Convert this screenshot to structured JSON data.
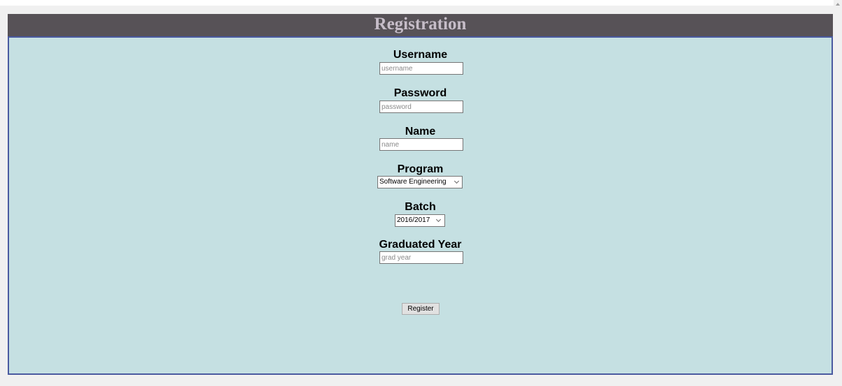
{
  "header": {
    "title": "Registration"
  },
  "form": {
    "username": {
      "label": "Username",
      "placeholder": "username",
      "value": ""
    },
    "password": {
      "label": "Password",
      "placeholder": "password",
      "value": ""
    },
    "name": {
      "label": "Name",
      "placeholder": "name",
      "value": ""
    },
    "program": {
      "label": "Program",
      "selected": "Software Engineering"
    },
    "batch": {
      "label": "Batch",
      "selected": "2016/2017"
    },
    "graduated_year": {
      "label": "Graduated Year",
      "placeholder": "grad year",
      "value": ""
    },
    "register_label": "Register"
  },
  "colors": {
    "header_bg": "#575257",
    "header_text": "#c6bdc8",
    "panel_bg": "#c5e0e2",
    "panel_border": "#4a5aa0"
  }
}
